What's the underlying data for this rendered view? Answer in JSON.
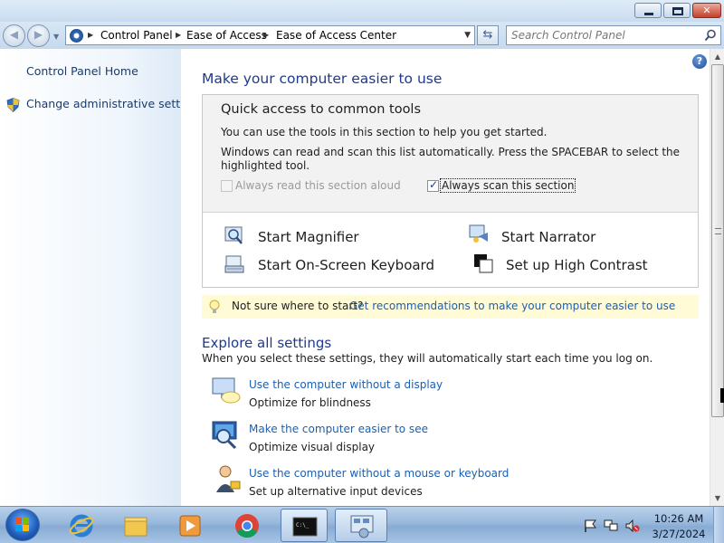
{
  "window": {
    "min_label": "minimize",
    "max_label": "maximize",
    "close_label": "close",
    "close_glyph": "✕"
  },
  "address": {
    "crumbs": [
      "Control Panel",
      "Ease of Access",
      "Ease of Access Center"
    ],
    "search_placeholder": "Search Control Panel"
  },
  "sidebar": {
    "items": [
      {
        "label": "Control Panel Home"
      },
      {
        "label": "Change administrative settings"
      }
    ]
  },
  "main": {
    "help_glyph": "?",
    "title": "Make your computer easier to use",
    "quick_access": {
      "heading": "Quick access to common tools",
      "text1": "You can use the tools in this section to help you get started.",
      "text2": "Windows can read and scan this list automatically.  Press the SPACEBAR to select the highlighted tool.",
      "option_read_aloud": {
        "label": "Always read this section aloud",
        "checked": false,
        "enabled": false
      },
      "option_scan": {
        "label": "Always scan this section",
        "checked": true,
        "enabled": true
      },
      "tools": [
        {
          "label": "Start Magnifier",
          "icon": "magnifier-icon"
        },
        {
          "label": "Start Narrator",
          "icon": "narrator-icon"
        },
        {
          "label": "Start On-Screen Keyboard",
          "icon": "keyboard-icon"
        },
        {
          "label": "Set up High Contrast",
          "icon": "high-contrast-icon"
        }
      ]
    },
    "tip": {
      "text": "Not sure where to start?",
      "link": "Get recommendations to make your computer easier to use"
    },
    "explore": {
      "title": "Explore all settings",
      "text": "When you select these settings, they will automatically start each time you log on.",
      "settings": [
        {
          "link": "Use the computer without a display",
          "desc": "Optimize for blindness",
          "icon": "display-speech-icon"
        },
        {
          "link": "Make the computer easier to see",
          "desc": "Optimize visual display",
          "icon": "magnify-monitor-icon"
        },
        {
          "link": "Use the computer without a mouse or keyboard",
          "desc": "Set up alternative input devices",
          "icon": "person-speech-icon"
        }
      ]
    }
  },
  "taskbar": {
    "apps": [
      "internet-explorer",
      "windows-explorer",
      "media-player",
      "chrome",
      "command-prompt",
      "control-panel"
    ],
    "active_app": "control-panel",
    "clock": {
      "time": "10:26 AM",
      "date": "3/27/2024"
    }
  },
  "colors": {
    "link": "#1c5fb0",
    "heading": "#1e3a8c",
    "tip_background": "#fffbd6"
  }
}
